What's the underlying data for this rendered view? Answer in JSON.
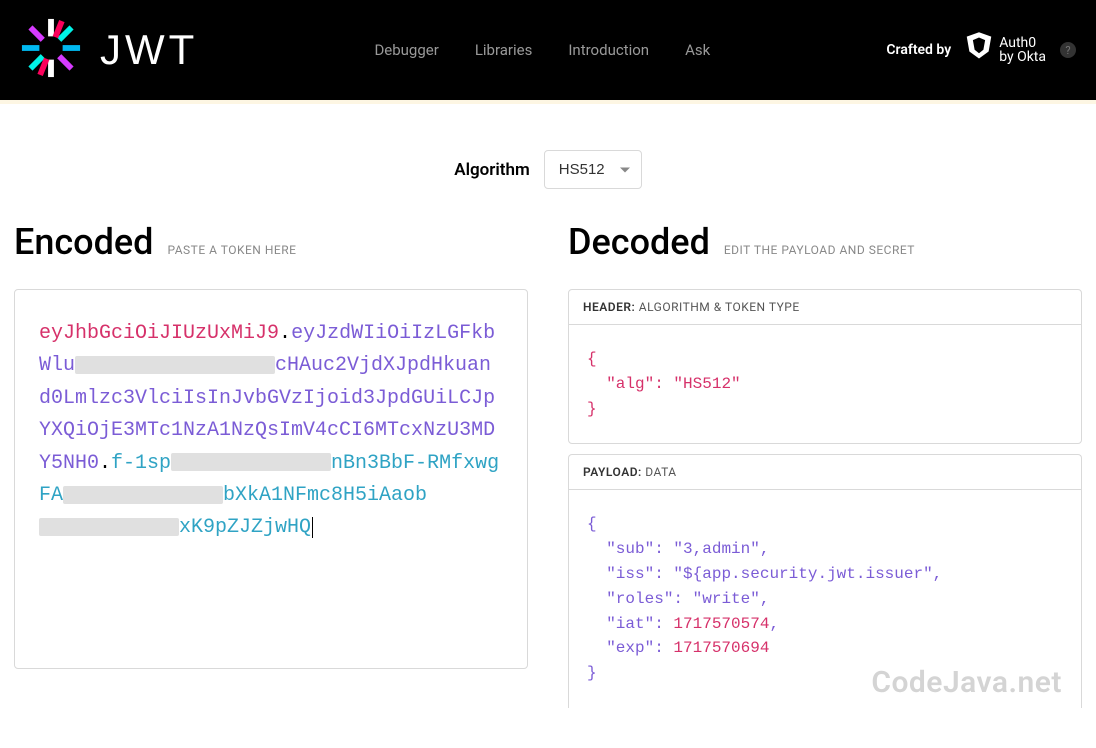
{
  "header": {
    "logo_text": "JWT",
    "nav": [
      "Debugger",
      "Libraries",
      "Introduction",
      "Ask"
    ],
    "crafted_by": "Crafted by",
    "auth0_line1": "Auth0",
    "auth0_line2": "by Okta",
    "help": "?"
  },
  "algorithm": {
    "label": "Algorithm",
    "selected": "HS512"
  },
  "encoded": {
    "title": "Encoded",
    "hint": "PASTE A TOKEN HERE",
    "token": {
      "header": "eyJhbGciOiJIUzUxMiJ9",
      "payload_pre": "eyJzdWIiOiIzLGFkbWlu",
      "payload_post": "cHAuc2VjdXJpdHkuand0Lmlzc3VlciIsInJvbGVzIjoid3JpdGUiLCJpYXQiOjE3MTc1NzA1NzQsImV4cCI6MTcxNzU3MDY5NH0",
      "sig_p1": "f-1sp",
      "sig_p2": "nBn3BbF-RMfxwgFA",
      "sig_p3": "bXkA1NFmc8H5iAaob",
      "sig_p4": "xK9pZJZjwHQ"
    }
  },
  "decoded": {
    "title": "Decoded",
    "hint": "EDIT THE PAYLOAD AND SECRET",
    "header_section": {
      "label": "HEADER:",
      "sub": "ALGORITHM & TOKEN TYPE"
    },
    "payload_section": {
      "label": "PAYLOAD:",
      "sub": "DATA"
    },
    "header_json": {
      "alg": "HS512"
    },
    "payload_json": {
      "sub": "3,admin",
      "iss": "${app.security.jwt.issuer",
      "roles": "write",
      "iat": 1717570574,
      "exp": 1717570694
    }
  },
  "watermark": "CodeJava.net"
}
